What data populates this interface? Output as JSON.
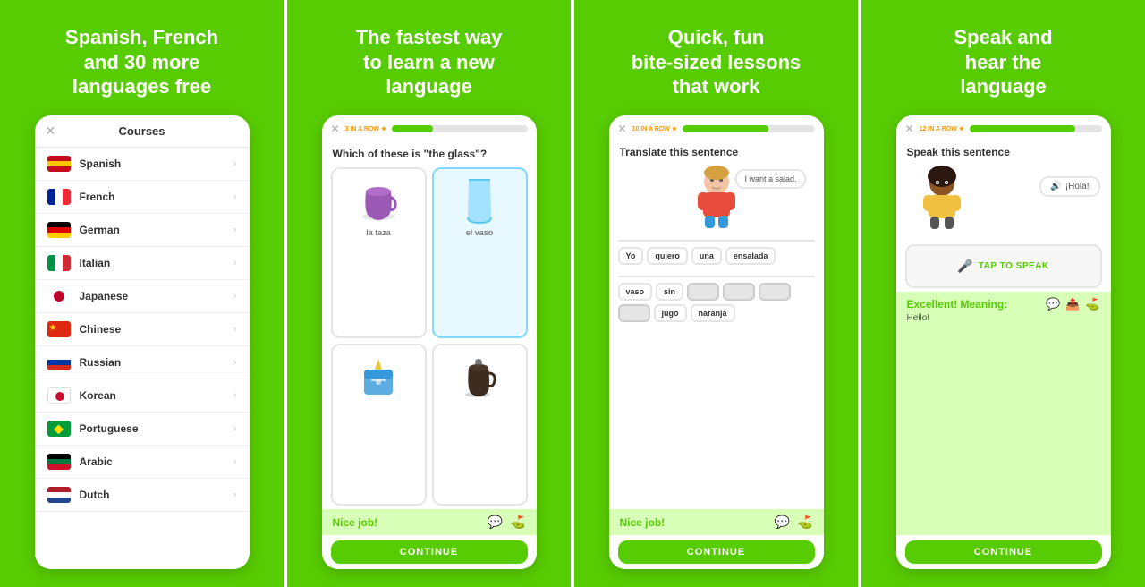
{
  "panels": [
    {
      "id": "panel1",
      "title": "Spanish, French\nand 30 more\nlanguages free",
      "phone": {
        "header": "Courses",
        "courses": [
          {
            "name": "Spanish",
            "flag": "spain"
          },
          {
            "name": "French",
            "flag": "france"
          },
          {
            "name": "German",
            "flag": "germany"
          },
          {
            "name": "Italian",
            "flag": "italy"
          },
          {
            "name": "Japanese",
            "flag": "japan"
          },
          {
            "name": "Chinese",
            "flag": "china"
          },
          {
            "name": "Russian",
            "flag": "russia"
          },
          {
            "name": "Korean",
            "flag": "korea"
          },
          {
            "name": "Portuguese",
            "flag": "brazil"
          },
          {
            "name": "Arabic",
            "flag": "arabic"
          },
          {
            "name": "Dutch",
            "flag": "netherlands"
          }
        ]
      }
    },
    {
      "id": "panel2",
      "title": "The fastest way\nto learn a new\nlanguage",
      "phone": {
        "streak": "3 IN A ROW",
        "progress": 30,
        "question": "Which of these is \"the glass\"?",
        "cards": [
          {
            "label": "la taza",
            "selected": false,
            "type": "cup"
          },
          {
            "label": "el vaso",
            "selected": true,
            "type": "glass"
          },
          {
            "label": "",
            "selected": false,
            "type": "sugar"
          },
          {
            "label": "",
            "selected": false,
            "type": "coffee"
          }
        ],
        "nice_job": "Nice job!",
        "continue_label": "CONTINUE"
      }
    },
    {
      "id": "panel3",
      "title": "Quick, fun\nbite-sized lessons\nthat work",
      "phone": {
        "streak": "10 IN A ROW",
        "progress": 65,
        "question": "Translate this sentence",
        "speech_text": "I  want  a  salad.",
        "word_chips_top": [
          "Yo",
          "quiero",
          "una",
          "ensalada"
        ],
        "word_chips_bottom": [
          "vaso",
          "sin",
          "",
          "",
          "",
          "jugo",
          "naranja"
        ],
        "nice_job": "Nice job!",
        "continue_label": "CONTINUE"
      }
    },
    {
      "id": "panel4",
      "title": "Speak and\nhear the\nlanguage",
      "phone": {
        "streak": "12 IN A ROW",
        "progress": 80,
        "question": "Speak this sentence",
        "speech_text": "¡Hola!",
        "tap_speak": "TAP TO SPEAK",
        "excellent_title": "Excellent! Meaning:",
        "excellent_meaning": "Hello!",
        "continue_label": "CONTINUE"
      }
    }
  ]
}
